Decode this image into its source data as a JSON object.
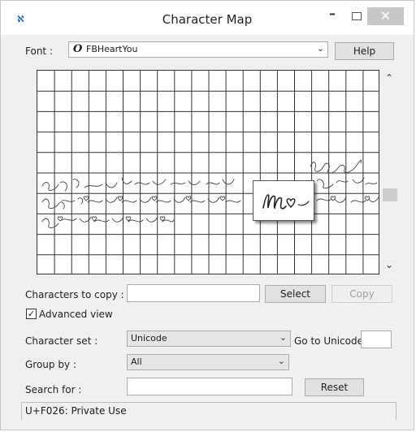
{
  "window": {
    "title": "Character Map",
    "app_icon_text": "ℵ",
    "minimize_glyph": "–",
    "close_glyph": "✕"
  },
  "font": {
    "label": "Font :",
    "value": "FBHeartYou",
    "glyph": "O",
    "help_label": "Help"
  },
  "grid": {
    "rows": 10,
    "cols": 20,
    "magnified_char": "m♡"
  },
  "copy": {
    "label": "Characters to copy :",
    "value": "",
    "select_label": "Select",
    "copy_label": "Copy"
  },
  "advanced_view": {
    "label": "Advanced view",
    "checked": true,
    "check_glyph": "✓"
  },
  "character_set": {
    "label": "Character set :",
    "value": "Unicode"
  },
  "go_to_unicode": {
    "label": "Go to Unicode :",
    "value": ""
  },
  "group_by": {
    "label": "Group by :",
    "value": "All"
  },
  "search": {
    "label": "Search for :",
    "value": "",
    "reset_label": "Reset"
  },
  "status": {
    "text": "U+F026: Private Use"
  }
}
